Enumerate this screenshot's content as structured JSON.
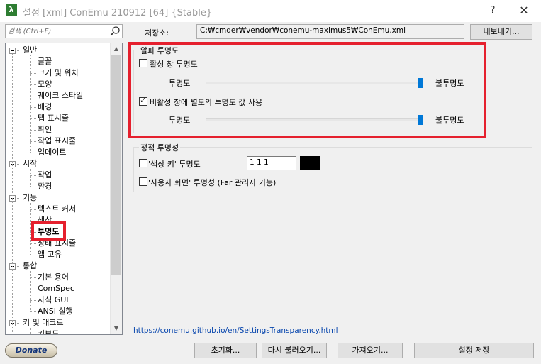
{
  "window": {
    "title": "설정 [xml] ConEmu 210912 [64] {Stable}",
    "app_icon": "λ",
    "help": "?",
    "close": "✕"
  },
  "search": {
    "placeholder": "검색 (Ctrl+F)"
  },
  "tree": {
    "nodes": [
      {
        "label": "일반",
        "level": 0
      },
      {
        "label": "글꼴",
        "level": 1
      },
      {
        "label": "크기 및 위치",
        "level": 1
      },
      {
        "label": "모양",
        "level": 1
      },
      {
        "label": "퀘이크 스타일",
        "level": 1
      },
      {
        "label": "배경",
        "level": 1
      },
      {
        "label": "탭 표시줄",
        "level": 1
      },
      {
        "label": "확인",
        "level": 1
      },
      {
        "label": "작업 표시줄",
        "level": 1
      },
      {
        "label": "업데이트",
        "level": 1
      },
      {
        "label": "시작",
        "level": 0
      },
      {
        "label": "작업",
        "level": 1
      },
      {
        "label": "환경",
        "level": 1
      },
      {
        "label": "기능",
        "level": 0
      },
      {
        "label": "텍스트 커서",
        "level": 1
      },
      {
        "label": "색상",
        "level": 1
      },
      {
        "label": "투명도",
        "level": 1,
        "selected": true
      },
      {
        "label": "상태 표시줄",
        "level": 1
      },
      {
        "label": "앱 고유",
        "level": 1
      },
      {
        "label": "통합",
        "level": 0
      },
      {
        "label": "기본 용어",
        "level": 1
      },
      {
        "label": "ComSpec",
        "level": 1
      },
      {
        "label": "자식 GUI",
        "level": 1
      },
      {
        "label": "ANSI 실행",
        "level": 1
      },
      {
        "label": "키 및 매크로",
        "level": 0
      },
      {
        "label": "키보드",
        "level": 1
      }
    ]
  },
  "donate_label": "Donate",
  "storage": {
    "label": "저장소:",
    "path": "C:₩cmder₩vendor₩conemu-maximus5₩ConEmu.xml",
    "export_label": "내보내기..."
  },
  "alpha": {
    "title": "알파 투명도",
    "active": {
      "label": "활성 창 투명도",
      "checked": false,
      "left": "투명도",
      "right": "불투명도",
      "value_percent": 100
    },
    "inactive": {
      "label": "비활성 창에 별도의 투명도 값 사용",
      "checked": true,
      "left": "투명도",
      "right": "불투명도",
      "value_percent": 100
    }
  },
  "static": {
    "title": "정적 투명성",
    "color_key": {
      "label": "'색상 키' 투명도",
      "checked": false,
      "value": "1 1 1",
      "swatch_color": "#000000"
    },
    "user_screen": {
      "label": "'사용자 화면' 투명성 (Far 관리자 기능)",
      "checked": false
    }
  },
  "help_link": "https://conemu.github.io/en/SettingsTransparency.html",
  "buttons": {
    "reset": "초기화...",
    "reload": "다시 불러오기...",
    "import": "가져오기...",
    "save": "설정 저장"
  },
  "colors": {
    "highlight": "#e5202e",
    "slider": "#0078d7"
  }
}
